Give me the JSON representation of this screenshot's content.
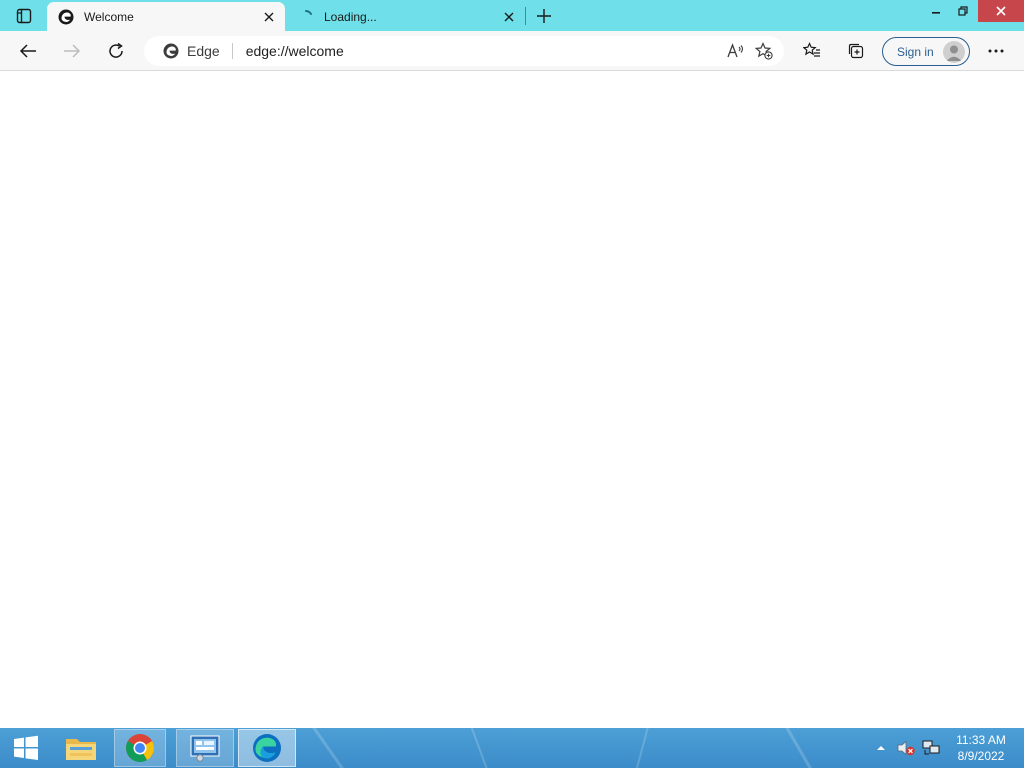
{
  "browser": {
    "tabs": [
      {
        "title": "Welcome",
        "state": "active"
      },
      {
        "title": "Loading...",
        "state": "loading"
      }
    ],
    "address_bar": {
      "site_label": "Edge",
      "url": "edge://welcome"
    },
    "sign_in_label": "Sign in",
    "colors": {
      "tabstrip": "#6fe0ea",
      "toolbar": "#f7f7f7",
      "close_button": "#c7464b",
      "accent": "#2a5f8f"
    }
  },
  "taskbar": {
    "pinned": [
      {
        "name": "file-explorer-icon"
      },
      {
        "name": "chrome-icon"
      },
      {
        "name": "control-panel-icon"
      },
      {
        "name": "edge-icon"
      }
    ],
    "clock": {
      "time": "11:33 AM",
      "date": "8/9/2022"
    }
  }
}
